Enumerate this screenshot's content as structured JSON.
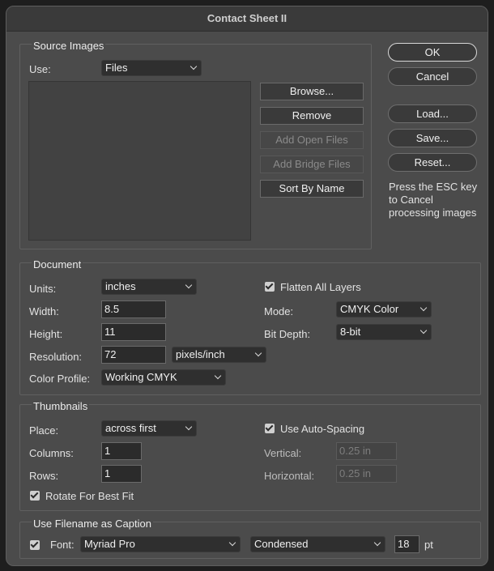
{
  "window": {
    "title": "Contact Sheet II"
  },
  "buttons": {
    "ok": "OK",
    "cancel": "Cancel",
    "load": "Load...",
    "save": "Save...",
    "reset": "Reset..."
  },
  "note": "Press the ESC key to Cancel processing images",
  "source": {
    "title": "Source Images",
    "use_label": "Use:",
    "use_value": "Files",
    "browse": "Browse...",
    "remove": "Remove",
    "add_open": "Add Open Files",
    "add_bridge": "Add Bridge Files",
    "sort": "Sort By Name"
  },
  "document": {
    "title": "Document",
    "units_label": "Units:",
    "units_value": "inches",
    "width_label": "Width:",
    "width_value": "8.5",
    "height_label": "Height:",
    "height_value": "11",
    "resolution_label": "Resolution:",
    "resolution_value": "72",
    "resolution_unit": "pixels/inch",
    "profile_label": "Color Profile:",
    "profile_value": "Working CMYK",
    "flatten_label": "Flatten All Layers",
    "flatten_checked": true,
    "mode_label": "Mode:",
    "mode_value": "CMYK Color",
    "bitdepth_label": "Bit Depth:",
    "bitdepth_value": "8-bit"
  },
  "thumbnails": {
    "title": "Thumbnails",
    "place_label": "Place:",
    "place_value": "across first",
    "columns_label": "Columns:",
    "columns_value": "1",
    "rows_label": "Rows:",
    "rows_value": "1",
    "rotate_label": "Rotate For Best Fit",
    "rotate_checked": true,
    "autospacing_label": "Use Auto-Spacing",
    "autospacing_checked": true,
    "vertical_label": "Vertical:",
    "vertical_value": "0.25 in",
    "horizontal_label": "Horizontal:",
    "horizontal_value": "0.25 in"
  },
  "caption": {
    "title": "Use Filename as Caption",
    "enabled": true,
    "font_label": "Font:",
    "font_value": "Myriad Pro",
    "style_value": "Condensed",
    "size_value": "18",
    "size_unit": "pt"
  }
}
